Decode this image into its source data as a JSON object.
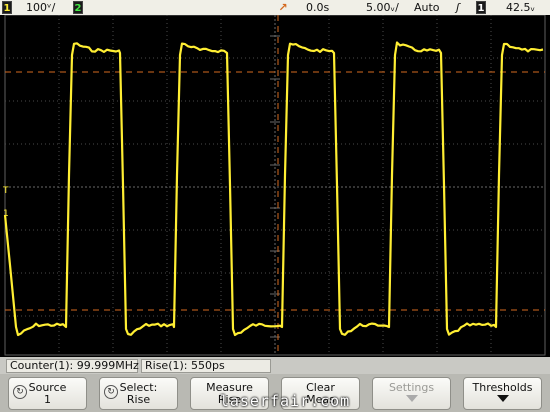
{
  "status_bar": {
    "channel_label": "1",
    "channel_scale": "100ᵛ/",
    "channel2_label": "2",
    "time_ref": "0.0s",
    "time_scale": "5.00ᵥ/",
    "trigger_mode": "Auto",
    "trigger_slope_symbol": "ʃ",
    "trigger_source": "1",
    "trigger_level": "42.5ᵥ"
  },
  "measurements": {
    "counter": "Counter(1): 99.999MHz",
    "rise": "Rise(1): 550ps"
  },
  "softkeys": [
    {
      "label": "Source\n1",
      "icon": "rotate-icon",
      "enabled": true
    },
    {
      "label": "Select:\nRise",
      "icon": "rotate-icon",
      "enabled": true
    },
    {
      "label": "Measure\nRise",
      "icon": "",
      "enabled": true
    },
    {
      "label": "Clear\nMeas",
      "icon": "",
      "enabled": true
    },
    {
      "label": "Settings",
      "icon": "down-arrow-icon",
      "enabled": false
    },
    {
      "label": "Thresholds",
      "icon": "down-arrow-icon",
      "enabled": true
    }
  ],
  "watermark": "laserfair.com",
  "colors": {
    "trace": "#ffee33",
    "trigger": "#d46a20",
    "grid": "#505050"
  }
}
